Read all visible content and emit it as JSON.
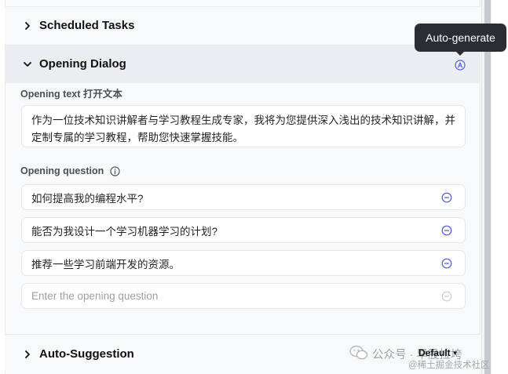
{
  "sections": {
    "scheduled_tasks": "Scheduled Tasks",
    "opening_dialog": "Opening Dialog",
    "auto_suggestion": "Auto-Suggestion"
  },
  "tooltip": {
    "text": "Auto-generate"
  },
  "opening_text": {
    "label": "Opening text 打开文本",
    "value": "作为一位技术知识讲解者与学习教程生成专家，我将为您提供深入浅出的技术知识讲解，并定制专属的学习教程，帮助您快速掌握技能。"
  },
  "opening_question": {
    "label": "Opening question",
    "items": [
      "如何提高我的编程水平?",
      "能否为我设计一个学习机器学习的计划?",
      "推荐一些学习前端开发的资源。"
    ],
    "placeholder": "Enter the opening question"
  },
  "auto_suggestion_select": {
    "value": "Default"
  },
  "watermark": {
    "main": "公众号 · 早股拉垮",
    "sub": "@稀土掘金技术社区"
  },
  "icons": {
    "expand": "chevron-right-icon",
    "collapse": "chevron-down-icon",
    "auto_generate": "auto-generate-icon",
    "info": "info-icon",
    "remove": "remove-circle-icon",
    "wechat": "wechat-icon"
  },
  "colors": {
    "accent": "#4d5bd6",
    "tooltip_bg": "#2b2d33",
    "active_header_bg": "#ebedf1"
  }
}
